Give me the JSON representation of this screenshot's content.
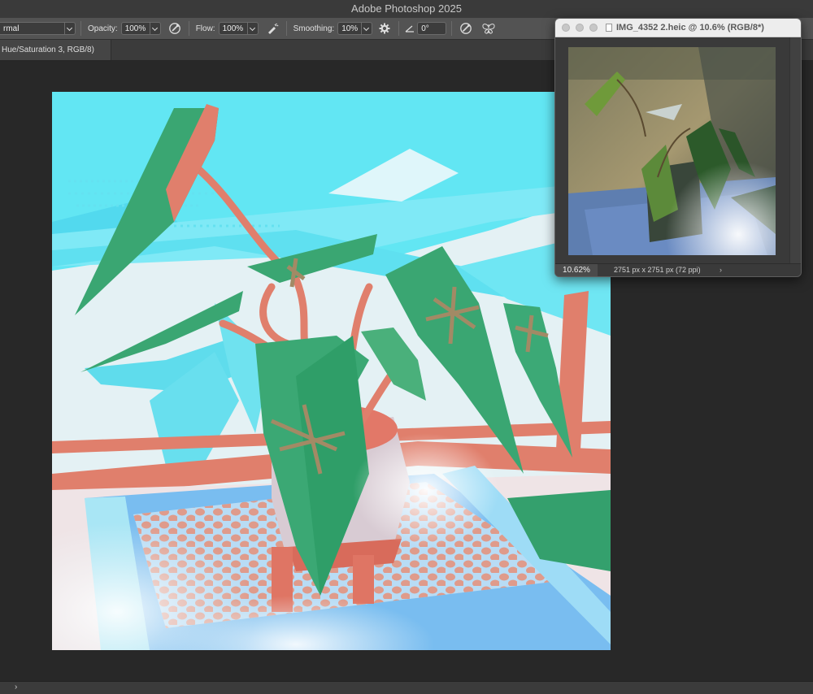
{
  "app": {
    "title": "Adobe Photoshop 2025"
  },
  "options_bar": {
    "blend_mode": "rmal",
    "opacity_label": "Opacity:",
    "opacity_value": "100%",
    "flow_label": "Flow:",
    "flow_value": "100%",
    "smoothing_label": "Smoothing:",
    "smoothing_value": "10%",
    "angle_value": "0°"
  },
  "document_tab": {
    "label": "Hue/Saturation 3, RGB/8)"
  },
  "float_window": {
    "title": "IMG_4352 2.heic @ 10.6% (RGB/8*)",
    "zoom": "10.62%",
    "dimensions": "2751 px x 2751 px (72 ppi)",
    "more_arrow": "›"
  },
  "status_bar": {
    "arrow": "›"
  },
  "colors": {
    "cyan": "#64e6f2",
    "pale": "#e3f2f5",
    "salmon": "#e07f6c",
    "green": "#3aa672",
    "leaf_dark": "#2e8c5f",
    "blue": "#6fb6ec"
  },
  "icons": [
    "airbrush-icon",
    "pressure-opacity-icon",
    "smoothing-gear-icon",
    "angle-icon",
    "pressure-size-icon",
    "symmetry-butterfly-icon"
  ]
}
